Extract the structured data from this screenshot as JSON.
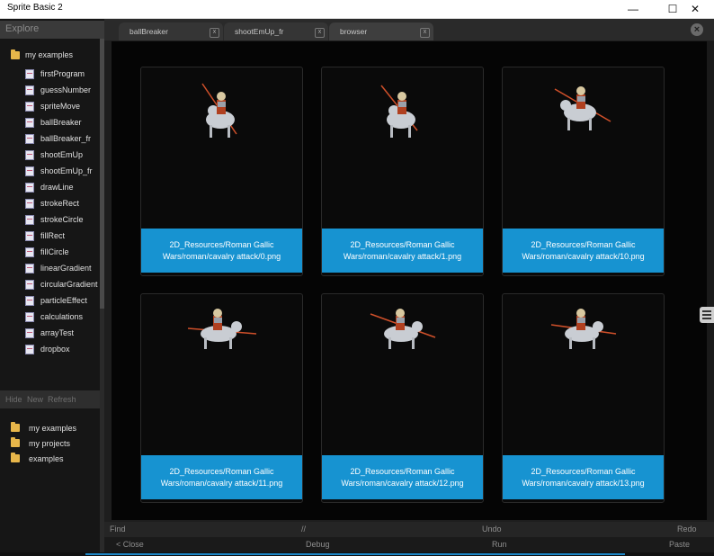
{
  "window": {
    "title": "Sprite Basic 2",
    "minimize": "—",
    "maximize": "☐",
    "close": "✕"
  },
  "sidebar": {
    "header": "Explore",
    "root_folder": "my examples",
    "files": [
      "firstProgram",
      "guessNumber",
      "spriteMove",
      "ballBreaker",
      "ballBreaker_fr",
      "shootEmUp",
      "shootEmUp_fr",
      "drawLine",
      "strokeRect",
      "strokeCircle",
      "fillRect",
      "fillCircle",
      "linearGradient",
      "circularGradient",
      "particleEffect",
      "calculations",
      "arrayTest",
      "dropbox"
    ],
    "actions": [
      "Hide",
      "New",
      "Refresh"
    ],
    "projects": [
      "my examples",
      "my projects",
      "examples"
    ]
  },
  "tabs": [
    {
      "label": "ballBreaker",
      "close": "x"
    },
    {
      "label": "shootEmUp_fr",
      "close": "x"
    },
    {
      "label": "browser",
      "close": "x"
    }
  ],
  "close_all": "×",
  "cards": [
    {
      "caption": "2D_Resources/Roman Gallic Wars/roman/cavalry attack/0.png"
    },
    {
      "caption": "2D_Resources/Roman Gallic Wars/roman/cavalry attack/1.png"
    },
    {
      "caption": "2D_Resources/Roman Gallic Wars/roman/cavalry attack/10.png"
    },
    {
      "caption": "2D_Resources/Roman Gallic Wars/roman/cavalry attack/11.png"
    },
    {
      "caption": "2D_Resources/Roman Gallic Wars/roman/cavalry attack/12.png"
    },
    {
      "caption": "2D_Resources/Roman Gallic Wars/roman/cavalry attack/13.png"
    }
  ],
  "toolbar1": {
    "find": "Find",
    "comment": "//",
    "undo": "Undo",
    "redo": "Redo"
  },
  "toolbar2": {
    "close": "< Close",
    "debug": "Debug",
    "run": "Run",
    "paste": "Paste"
  },
  "colors": {
    "accent": "#1793d1",
    "background": "#1e1e1e",
    "folder": "#e7b64a"
  }
}
